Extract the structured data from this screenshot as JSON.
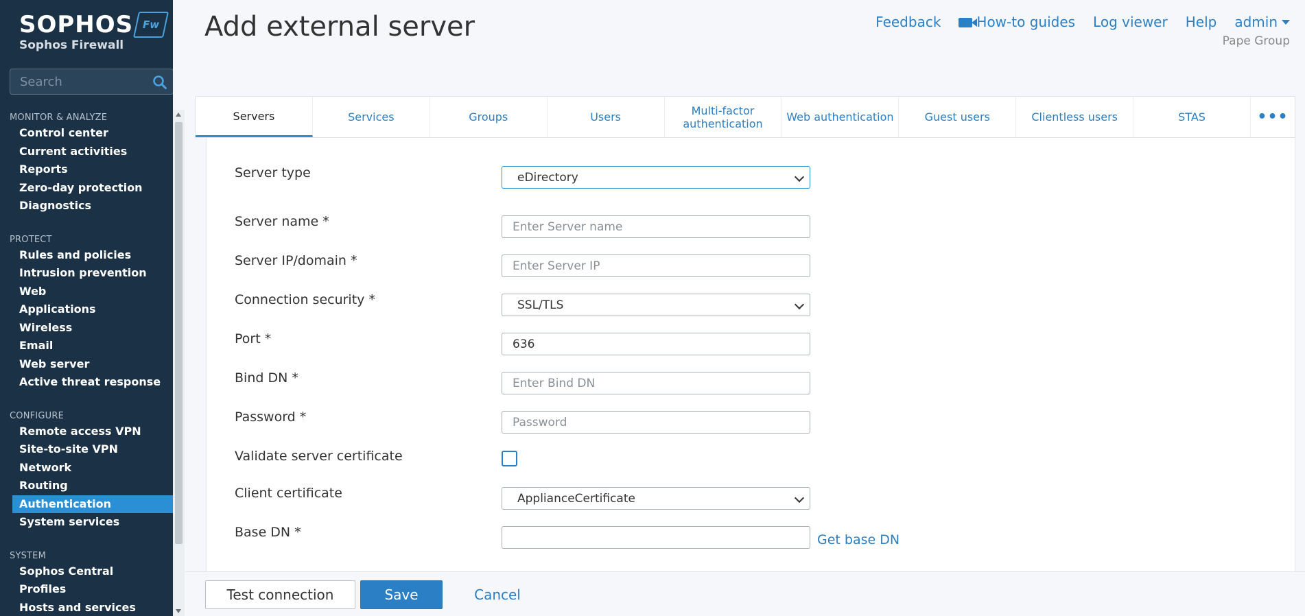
{
  "brand": {
    "name": "SOPHOS",
    "badge": "Fw",
    "product": "Sophos Firewall"
  },
  "search": {
    "placeholder": "Search"
  },
  "nav": {
    "sections": [
      {
        "title": "MONITOR & ANALYZE",
        "items": [
          "Control center",
          "Current activities",
          "Reports",
          "Zero-day protection",
          "Diagnostics"
        ]
      },
      {
        "title": "PROTECT",
        "items": [
          "Rules and policies",
          "Intrusion prevention",
          "Web",
          "Applications",
          "Wireless",
          "Email",
          "Web server",
          "Active threat response"
        ]
      },
      {
        "title": "CONFIGURE",
        "items": [
          "Remote access VPN",
          "Site-to-site VPN",
          "Network",
          "Routing",
          "Authentication",
          "System services"
        ]
      },
      {
        "title": "SYSTEM",
        "items": [
          "Sophos Central",
          "Profiles",
          "Hosts and services"
        ]
      }
    ],
    "active": "Authentication"
  },
  "header": {
    "title": "Add external server",
    "links": {
      "feedback": "Feedback",
      "howto": "How-to guides",
      "logviewer": "Log viewer",
      "help": "Help",
      "user": "admin"
    },
    "org": "Pape Group"
  },
  "tabs": [
    "Servers",
    "Services",
    "Groups",
    "Users",
    "Multi-factor authentication",
    "Web authentication",
    "Guest users",
    "Clientless users",
    "STAS",
    "•••"
  ],
  "active_tab": "Servers",
  "form": {
    "server_type": {
      "label": "Server type",
      "value": "eDirectory"
    },
    "server_name": {
      "label": "Server name *",
      "placeholder": "Enter Server name"
    },
    "server_ip": {
      "label": "Server IP/domain *",
      "placeholder": "Enter Server IP"
    },
    "connection_security": {
      "label": "Connection security *",
      "value": "SSL/TLS"
    },
    "port": {
      "label": "Port *",
      "value": "636"
    },
    "bind_dn": {
      "label": "Bind DN *",
      "placeholder": "Enter Bind DN"
    },
    "password": {
      "label": "Password *",
      "placeholder": "Password"
    },
    "validate_cert": {
      "label": "Validate server certificate",
      "checked": false
    },
    "client_cert": {
      "label": "Client certificate",
      "value": "ApplianceCertificate"
    },
    "base_dn": {
      "label": "Base DN *",
      "value": "",
      "link": "Get base DN"
    }
  },
  "footer": {
    "test": "Test connection",
    "save": "Save",
    "cancel": "Cancel"
  },
  "colors": {
    "sidebar": "#1b3246",
    "accent": "#2b8fd6",
    "link": "#2b7fc4"
  }
}
